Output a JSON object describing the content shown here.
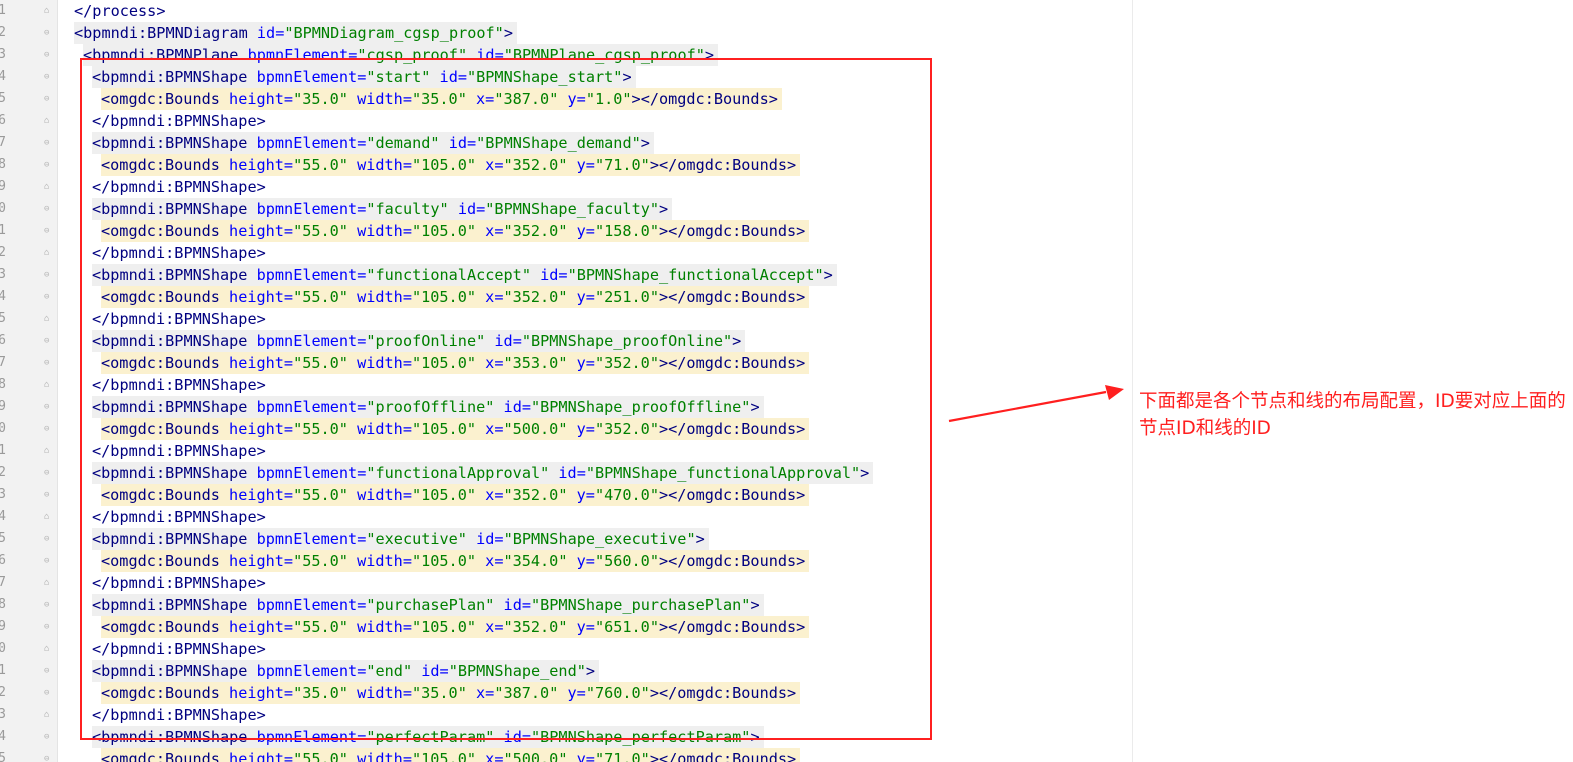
{
  "editor": {
    "visible_line_numbers_partial": [
      "1",
      "2",
      "3",
      "4",
      "5",
      "6",
      "7",
      "8",
      "9",
      "0",
      "1",
      "2",
      "3",
      "4",
      "5",
      "6",
      "7",
      "8",
      "9",
      "0",
      "1",
      "2",
      "3",
      "4",
      "5",
      "6",
      "7",
      "8",
      "9",
      "0",
      "1",
      "2",
      "3",
      "4",
      "5"
    ],
    "lines": [
      "</process>",
      "<bpmndi:BPMNDiagram id=\"BPMNDiagram_cgsp_proof\">",
      "  <bpmndi:BPMNPlane bpmnElement=\"cgsp_proof\" id=\"BPMNPlane_cgsp_proof\">",
      "    <bpmndi:BPMNShape bpmnElement=\"start\" id=\"BPMNShape_start\">",
      "      <omgdc:Bounds height=\"35.0\" width=\"35.0\" x=\"387.0\" y=\"1.0\"></omgdc:Bounds>",
      "    </bpmndi:BPMNShape>",
      "    <bpmndi:BPMNShape bpmnElement=\"demand\" id=\"BPMNShape_demand\">",
      "      <omgdc:Bounds height=\"55.0\" width=\"105.0\" x=\"352.0\" y=\"71.0\"></omgdc:Bounds>",
      "    </bpmndi:BPMNShape>",
      "    <bpmndi:BPMNShape bpmnElement=\"faculty\" id=\"BPMNShape_faculty\">",
      "      <omgdc:Bounds height=\"55.0\" width=\"105.0\" x=\"352.0\" y=\"158.0\"></omgdc:Bounds>",
      "    </bpmndi:BPMNShape>",
      "    <bpmndi:BPMNShape bpmnElement=\"functionalAccept\" id=\"BPMNShape_functionalAccept\">",
      "      <omgdc:Bounds height=\"55.0\" width=\"105.0\" x=\"352.0\" y=\"251.0\"></omgdc:Bounds>",
      "    </bpmndi:BPMNShape>",
      "    <bpmndi:BPMNShape bpmnElement=\"proofOnline\" id=\"BPMNShape_proofOnline\">",
      "      <omgdc:Bounds height=\"55.0\" width=\"105.0\" x=\"353.0\" y=\"352.0\"></omgdc:Bounds>",
      "    </bpmndi:BPMNShape>",
      "    <bpmndi:BPMNShape bpmnElement=\"proofOffline\" id=\"BPMNShape_proofOffline\">",
      "      <omgdc:Bounds height=\"55.0\" width=\"105.0\" x=\"500.0\" y=\"352.0\"></omgdc:Bounds>",
      "    </bpmndi:BPMNShape>",
      "    <bpmndi:BPMNShape bpmnElement=\"functionalApproval\" id=\"BPMNShape_functionalApproval\">",
      "      <omgdc:Bounds height=\"55.0\" width=\"105.0\" x=\"352.0\" y=\"470.0\"></omgdc:Bounds>",
      "    </bpmndi:BPMNShape>",
      "    <bpmndi:BPMNShape bpmnElement=\"executive\" id=\"BPMNShape_executive\">",
      "      <omgdc:Bounds height=\"55.0\" width=\"105.0\" x=\"354.0\" y=\"560.0\"></omgdc:Bounds>",
      "    </bpmndi:BPMNShape>",
      "    <bpmndi:BPMNShape bpmnElement=\"purchasePlan\" id=\"BPMNShape_purchasePlan\">",
      "      <omgdc:Bounds height=\"55.0\" width=\"105.0\" x=\"352.0\" y=\"651.0\"></omgdc:Bounds>",
      "    </bpmndi:BPMNShape>",
      "    <bpmndi:BPMNShape bpmnElement=\"end\" id=\"BPMNShape_end\">",
      "      <omgdc:Bounds height=\"35.0\" width=\"35.0\" x=\"387.0\" y=\"760.0\"></omgdc:Bounds>",
      "    </bpmndi:BPMNShape>",
      "    <bpmndi:BPMNShape bpmnElement=\"perfectParam\" id=\"BPMNShape_perfectParam\">",
      "      <omgdc:Bounds height=\"55.0\" width=\"105.0\" x=\"500.0\" y=\"71.0\"></omgdc:Bounds>"
    ]
  },
  "annotation": {
    "text": "下面都是各个节点和线的布局配置，ID要对应上面的节点ID和线的ID",
    "color": "#ff1f1f"
  }
}
